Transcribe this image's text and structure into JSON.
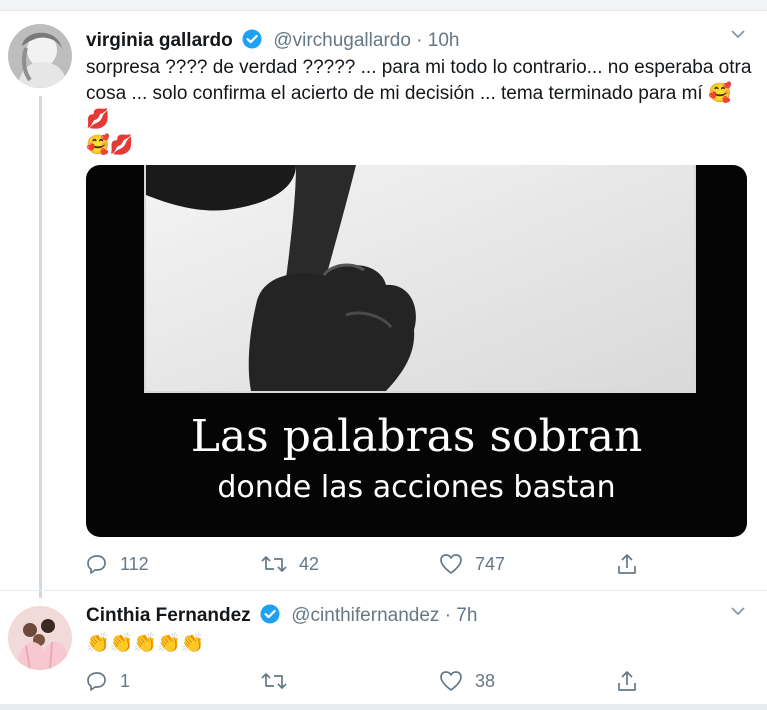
{
  "colors": {
    "accent": "#1da1f2",
    "text": "#14171a",
    "muted": "#657786",
    "line": "#cfd9de"
  },
  "tweets": [
    {
      "name": "virginia gallardo",
      "handle": "@virchugallardo",
      "separator": "·",
      "time": "10h",
      "text_line1": "sorpresa ???? de verdad ????? ... para mi todo lo contrario... no esperaba otra",
      "text_line2": "cosa ... solo confirma el acierto de mi decisión ... tema terminado para mí",
      "emoji_after_line2": "🥰",
      "emoji_line3": "💋",
      "emoji_line4": "🥰💋",
      "media": {
        "caption_main": "Las palabras sobran",
        "caption_sub": "donde las acciones bastan"
      },
      "stats": {
        "replies": "112",
        "retweets": "42",
        "likes": "747"
      }
    },
    {
      "name": "Cinthia Fernandez",
      "handle": "@cinthifernandez",
      "separator": "·",
      "time": "7h",
      "text_line1": "👏👏👏👏👏",
      "stats": {
        "replies": "1",
        "retweets": "",
        "likes": "38"
      }
    }
  ],
  "icons": [
    "verified-badge-icon",
    "chevron-down-icon",
    "reply-icon",
    "retweet-icon",
    "like-icon",
    "share-icon"
  ]
}
